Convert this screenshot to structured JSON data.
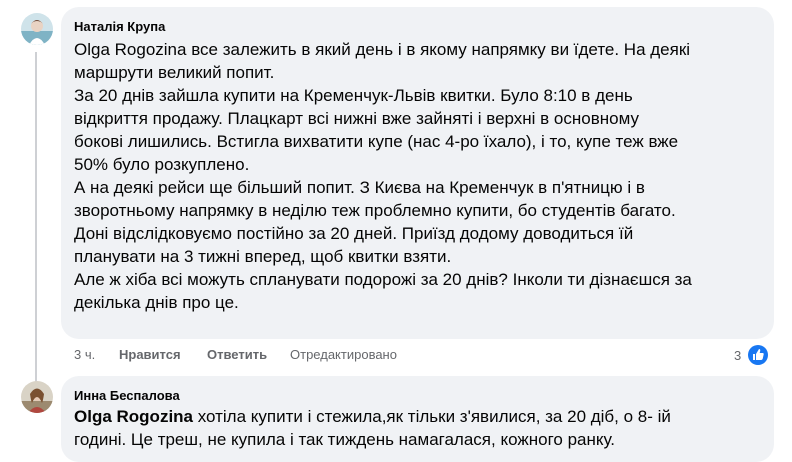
{
  "comments": [
    {
      "author": "Наталія Крупа",
      "mention": "Olga Rogozina",
      "paragraphs": [
        " все залежить в який день і в якому напрямку ви їдете. На деякі",
        "маршрути великий попит.",
        "За 20 днів зайшла купити на Кременчук-Львів квитки. Було 8:10 в день",
        "відкриття продажу. Плацкарт всі нижні вже зайняті і верхні в основному",
        "бокові лишились. Встигла вихватити купе (нас 4-ро їхало), і то, купе теж вже",
        "50% було розкуплено.",
        "А на деякі рейси ще більший попит. З Києва на Кременчук в п'ятницю і в",
        "зворотньому напрямку в неділю теж проблемно купити, бо студентів багато.",
        "Доні відслідковуємо постійно за 20 дней. Приїзд додому доводиться їй",
        "планувати на 3 тижні вперед, щоб квитки взяти.",
        "Але ж хіба всі можуть спланувати подорожі за 20 днів? Інколи ти дізнаєшся за",
        "декілька днів про це."
      ],
      "time": "3 ч.",
      "like_label": "Нравится",
      "reply_label": "Ответить",
      "edited_label": "Отредактировано",
      "reaction_count": "3"
    },
    {
      "author": "Инна Беспалова",
      "mention": "Olga Rogozina",
      "paragraphs": [
        " хотіла купити і стежила,як тільки з'явилися, за 20 діб, о 8- ій",
        "годині. Це треш, не купила і так тиждень намагалася, кожного ранку."
      ]
    }
  ],
  "colors": {
    "bubble": "#f0f2f5",
    "meta": "#65676b",
    "like_blue": "#1877f2"
  }
}
